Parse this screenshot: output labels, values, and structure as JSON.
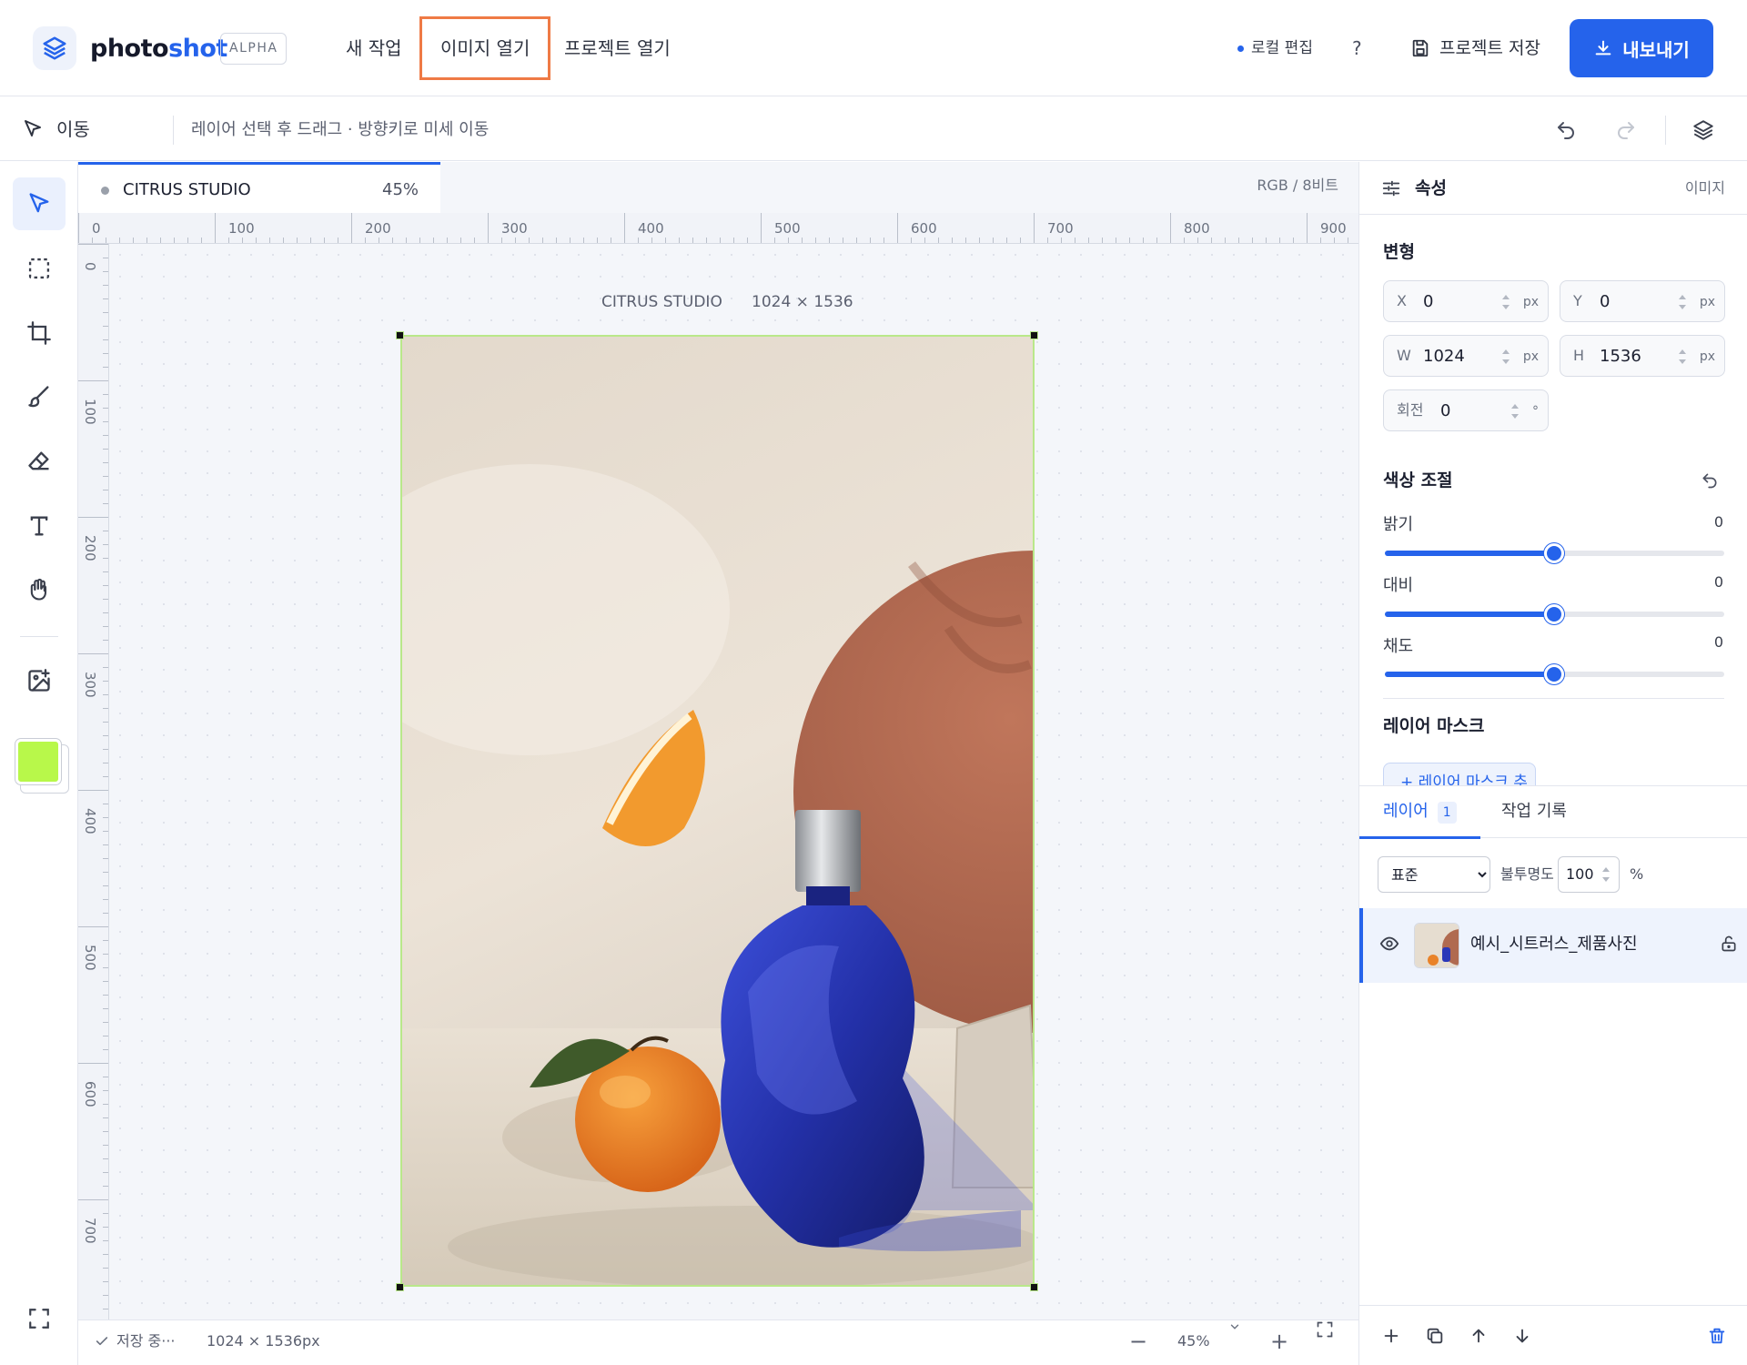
{
  "app": {
    "brand_part1": "photo",
    "brand_part2": "shot",
    "badge": "ALPHA"
  },
  "menu": {
    "new_task": "새 작업",
    "open_image": "이미지 열기",
    "open_project": "프로젝트 열기"
  },
  "header": {
    "local_edit": "로컬 편집",
    "help": "?",
    "save_project": "프로젝트 저장",
    "export": "내보내기"
  },
  "options": {
    "current_tool": "이동",
    "hint": "레이어 선택 후 드래그 · 방향키로 미세 이동"
  },
  "document": {
    "name": "CITRUS STUDIO",
    "zoom": "45%",
    "color_mode": "RGB / 8비트",
    "size": "1024 × 1536"
  },
  "ruler": {
    "h": [
      "0",
      "100",
      "200",
      "300",
      "400",
      "500",
      "600",
      "700",
      "800",
      "900"
    ],
    "v": [
      "0",
      "100",
      "200",
      "300",
      "400",
      "500",
      "600",
      "700"
    ]
  },
  "status": {
    "saving": "저장 중···",
    "size": "1024 × 1536px",
    "zoom": "45%"
  },
  "colors": {
    "accent": "#2563eb",
    "foreground": "#b8f84a",
    "highlight": "#ef7a45"
  },
  "properties": {
    "title": "속성",
    "tag": "이미지",
    "transform": {
      "title": "변형",
      "x": {
        "label": "X",
        "value": "0",
        "unit": "px"
      },
      "y": {
        "label": "Y",
        "value": "0",
        "unit": "px"
      },
      "w": {
        "label": "W",
        "value": "1024",
        "unit": "px"
      },
      "h": {
        "label": "H",
        "value": "1536",
        "unit": "px"
      },
      "rotation": {
        "label": "회전",
        "value": "0",
        "unit": "°"
      }
    },
    "color_adjust": {
      "title": "색상 조절",
      "brightness": {
        "label": "밝기",
        "value": "0"
      },
      "contrast": {
        "label": "대비",
        "value": "0"
      },
      "saturation": {
        "label": "채도",
        "value": "0"
      }
    },
    "mask": {
      "title": "레이어 마스크",
      "add_button": "+ 레이어 마스크 추가"
    }
  },
  "layers": {
    "tab_layers": "레이어",
    "count": "1",
    "tab_history": "작업 기록",
    "blend_mode": "표준",
    "blend_options": [
      "표준"
    ],
    "opacity_label": "불투명도",
    "opacity": "100",
    "opacity_unit": "%",
    "items": [
      {
        "name": "예시_시트러스_제품사진"
      }
    ]
  }
}
